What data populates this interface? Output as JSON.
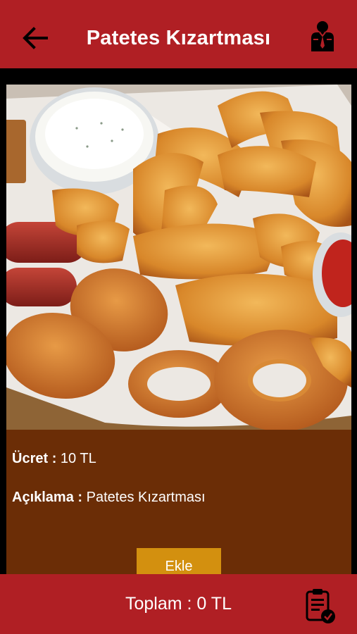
{
  "header": {
    "title": "Patetes Kızartması",
    "back_icon": "arrow-left-icon",
    "profile_icon": "user-profile-icon"
  },
  "product": {
    "image_subject": "potato wedges, onion rings, croquettes and sausages with dips",
    "price_label": "Ücret :",
    "price_value": "10 TL",
    "description_label": "Açıklama :",
    "description_value": "Patetes Kızartması",
    "add_button": "Ekle"
  },
  "footer": {
    "total_text": "Toplam : 0 TL",
    "cart_icon": "order-checklist-icon"
  },
  "colors": {
    "bar": "#b01f24",
    "info_panel": "#6b2d06",
    "add_button": "#d3900f",
    "background": "#000000"
  }
}
